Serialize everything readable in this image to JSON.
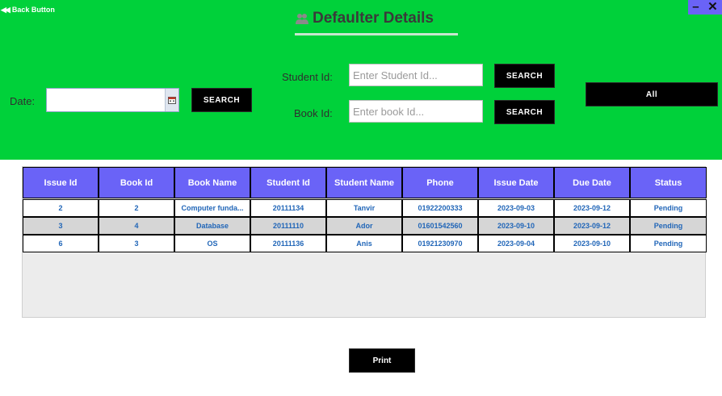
{
  "header": {
    "back_label": "Back Button",
    "title": "Defaulter Details",
    "minimize": "–",
    "close": "✕"
  },
  "search": {
    "date_label": "Date:",
    "date_value": "",
    "date_search": "SEARCH",
    "student_label": "Student Id:",
    "student_placeholder": "Enter Student Id...",
    "student_search": "SEARCH",
    "book_label": "Book Id:",
    "book_placeholder": "Enter book Id...",
    "book_search": "SEARCH",
    "all_button": "All"
  },
  "table": {
    "columns": [
      "Issue Id",
      "Book Id",
      "Book Name",
      "Student Id",
      "Student Name",
      "Phone",
      "Issue Date",
      "Due Date",
      "Status"
    ],
    "rows": [
      [
        "2",
        "2",
        "Computer funda...",
        "20111134",
        "Tanvir",
        "01922200333",
        "2023-09-03",
        "2023-09-12",
        "Pending"
      ],
      [
        "3",
        "4",
        "Database",
        "20111110",
        "Ador",
        "01601542560",
        "2023-09-10",
        "2023-09-12",
        "Pending"
      ],
      [
        "6",
        "3",
        "OS",
        "20111136",
        "Anis",
        "01921230970",
        "2023-09-04",
        "2023-09-10",
        "Pending"
      ]
    ]
  },
  "print_label": "Print",
  "colors": {
    "header_bg": "#00d13a",
    "table_header_bg": "#6a63f7",
    "cell_text": "#2166b8",
    "button_bg": "#000000"
  }
}
